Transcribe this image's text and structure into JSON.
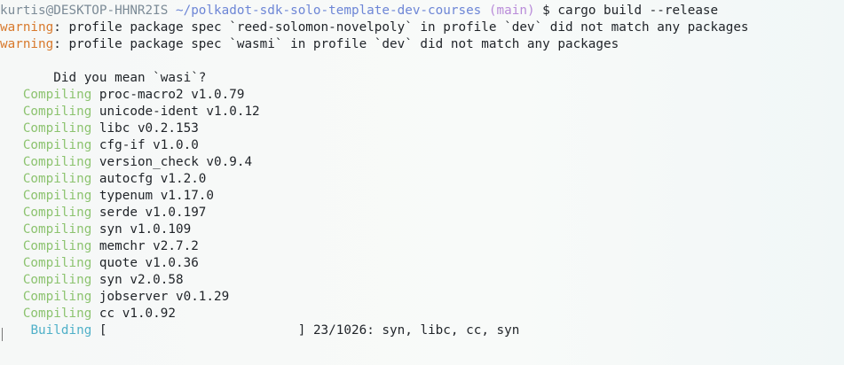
{
  "prompt": {
    "user_host": "kurtis@DESKTOP-HHNR2IS",
    "path": "~/polkadot-sdk-solo-template-dev-courses",
    "branch": "(main)",
    "symbol": "$",
    "command": "cargo build --release"
  },
  "warnings": [
    {
      "label": "warning",
      "text": ": profile package spec `reed-solomon-novelpoly` in profile `dev` did not match any packages"
    },
    {
      "label": "warning",
      "text": ": profile package spec `wasmi` in profile `dev` did not match any packages"
    }
  ],
  "suggestion": "Did you mean `wasi`?",
  "compiling_label": "Compiling",
  "compiling": [
    "proc-macro2 v1.0.79",
    "unicode-ident v1.0.12",
    "libc v0.2.153",
    "cfg-if v1.0.0",
    "version_check v0.9.4",
    "autocfg v1.2.0",
    "typenum v1.17.0",
    "serde v1.0.197",
    "syn v1.0.109",
    "memchr v2.7.2",
    "quote v1.0.36",
    "syn v2.0.58",
    "jobserver v0.1.29",
    "cc v1.0.92"
  ],
  "building": {
    "label": "Building",
    "bar_open": "[",
    "bar_close": "]",
    "progress": "23/1026",
    "progress_fraction": 0.0224,
    "status": ": syn, libc, cc, syn"
  },
  "colors": {
    "warning": "#d8792c",
    "compiling": "#8cc36f",
    "building": "#4fb0c8",
    "path": "#6d86d6",
    "branch": "#b98bd9"
  }
}
